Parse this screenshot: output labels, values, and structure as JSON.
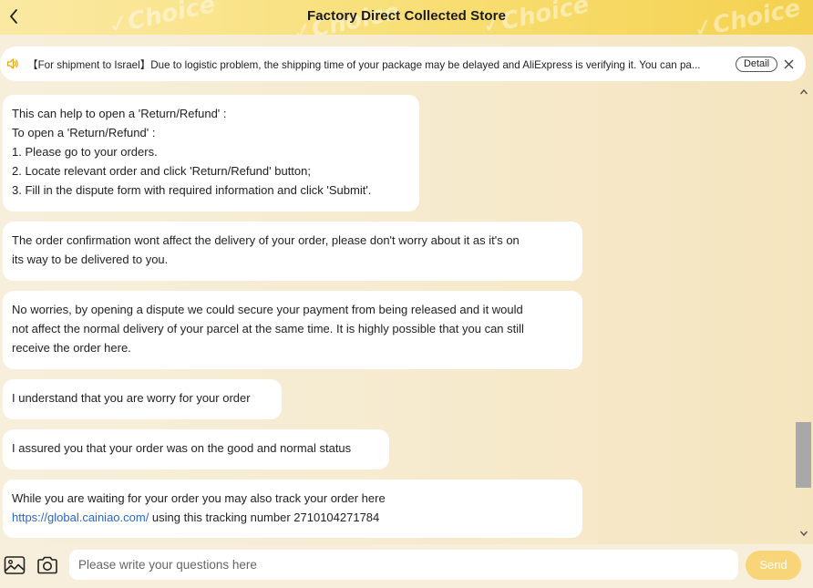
{
  "header": {
    "title": "Factory Direct Collected Store",
    "watermark": "✓Choice",
    "back_icon": "chevron-left-icon"
  },
  "notice": {
    "icon": "speaker-icon",
    "text": "【For shipment to Israel】Due to logistic problem, the shipping time of your package may be delayed and AliExpress is verifying it. You can pa...",
    "detail_label": "Detail",
    "close_icon": "close-icon"
  },
  "messages": [
    {
      "lines": [
        "This can help to open a 'Return/Refund' :",
        "To open a 'Return/Refund' :",
        "1. Please go to your orders.",
        "2. Locate relevant order and click 'Return/Refund' button;",
        "3. Fill in the dispute form with required information and click 'Submit'."
      ]
    },
    {
      "lines": [
        "The order confirmation wont affect the delivery of your order, please don't worry about it as it's on",
        "its way to be delivered to you."
      ]
    },
    {
      "lines": [
        "No worries, by opening a dispute we could secure your payment from being released and it would",
        "not affect the normal delivery of your parcel at the same time. It is highly possible that you can still",
        "receive the order here."
      ]
    },
    {
      "lines": [
        "I understand that you are worry for your order"
      ]
    },
    {
      "lines": [
        "I assured you that your order was on the good and normal status"
      ]
    },
    {
      "lines": [
        "While you are waiting for your order you may also track your order here"
      ],
      "link": "https://global.cainiao.com/",
      "link_suffix": " using this tracking number 2710104271784"
    }
  ],
  "input": {
    "placeholder": "Please write your questions here",
    "value": "",
    "send_label": "Send",
    "image_icon": "image-icon",
    "camera_icon": "camera-icon"
  },
  "colors": {
    "header_gradient_start": "#fbe9a3",
    "header_gradient_end": "#f4d14f",
    "send_button": "#f9d57a",
    "link": "#2a66c9",
    "background": "#f6ecd6"
  }
}
